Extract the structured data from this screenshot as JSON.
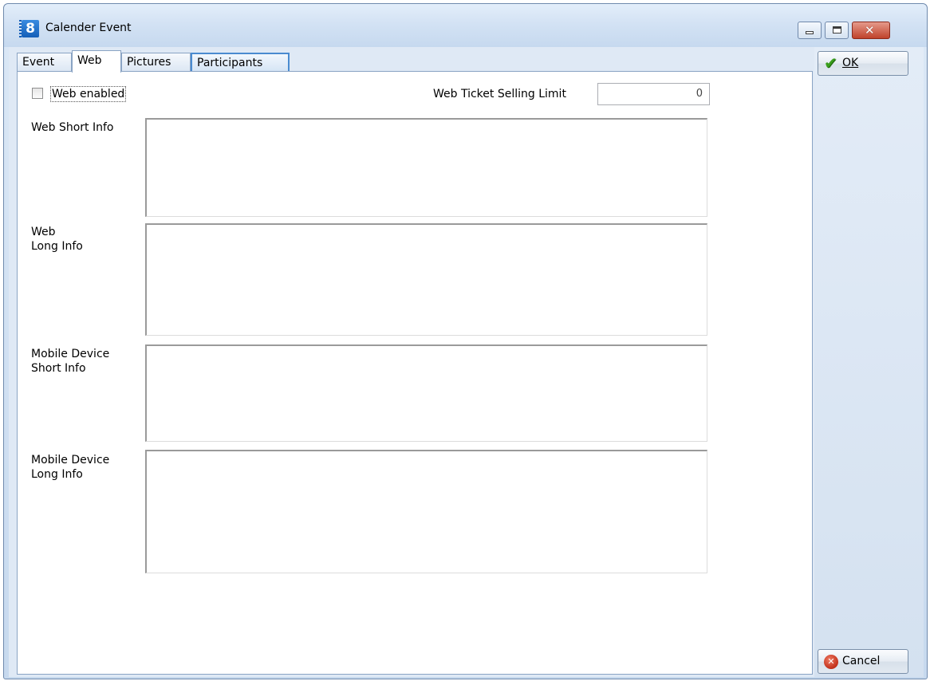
{
  "window": {
    "title": "Calender Event",
    "app_icon_text": "8"
  },
  "tabs": [
    {
      "label": "Event"
    },
    {
      "label": "Web",
      "active": true
    },
    {
      "label": "Pictures"
    },
    {
      "label": "Participants"
    }
  ],
  "web": {
    "web_enabled_label": "Web enabled",
    "web_enabled_checked": false,
    "ticket_limit_label": "Web Ticket Selling Limit",
    "ticket_limit_value": "0",
    "short_info_label": "Web Short Info",
    "long_info_label": "Web\nLong Info",
    "mobile_short_label": "Mobile Device\nShort Info",
    "mobile_long_label": "Mobile Device\nLong Info",
    "short_info_value": "",
    "long_info_value": "",
    "mobile_short_value": "",
    "mobile_long_value": ""
  },
  "buttons": {
    "ok_label": "OK",
    "cancel_label": "Cancel"
  },
  "icons": {
    "ok": "checkmark-icon",
    "cancel": "cancel-x-icon",
    "minimize": "minimize-icon",
    "maximize": "maximize-icon",
    "close": "close-icon"
  }
}
